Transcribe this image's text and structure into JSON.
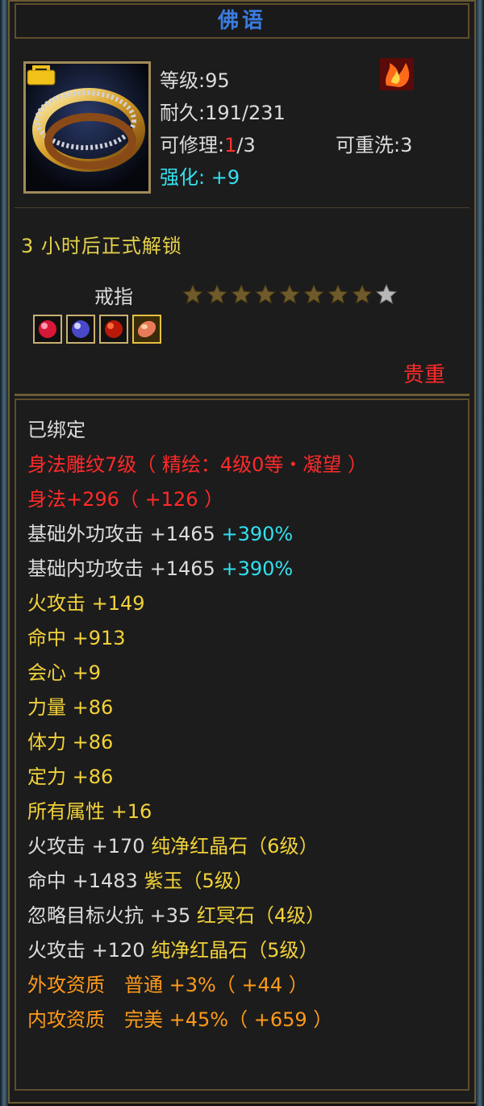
{
  "window": {
    "title": "佛语"
  },
  "item": {
    "level": "等级:95",
    "durability": "耐久:191/231",
    "repair_label": "可修理:",
    "repair_used": "1",
    "repair_total": "/3",
    "rewash": "可重洗:3",
    "enhance_label": "强化:",
    "enhance_value": "+9",
    "unlock_text": "3 小时后正式解锁",
    "type": "戒指",
    "star_rating": {
      "filled": 8,
      "total": 9
    },
    "rarity": "贵重"
  },
  "attributes": [
    {
      "parts": [
        {
          "text": "已绑定",
          "color": "white"
        }
      ]
    },
    {
      "parts": [
        {
          "text": "身法雕纹7级（ 精绘：4级0等・凝望 ）",
          "color": "red"
        }
      ]
    },
    {
      "parts": [
        {
          "text": "身法+296（ +126 ）",
          "color": "red"
        }
      ]
    },
    {
      "parts": [
        {
          "text": "基础外功攻击 +1465 ",
          "color": "white"
        },
        {
          "text": "+390%",
          "color": "cyan"
        }
      ]
    },
    {
      "parts": [
        {
          "text": "基础内功攻击 +1465 ",
          "color": "white"
        },
        {
          "text": "+390%",
          "color": "cyan"
        }
      ]
    },
    {
      "parts": [
        {
          "text": "火攻击 +149",
          "color": "yellow"
        }
      ]
    },
    {
      "parts": [
        {
          "text": "命中 +913",
          "color": "yellow"
        }
      ]
    },
    {
      "parts": [
        {
          "text": "会心 +9",
          "color": "yellow"
        }
      ]
    },
    {
      "parts": [
        {
          "text": "力量 +86",
          "color": "yellow"
        }
      ]
    },
    {
      "parts": [
        {
          "text": "体力 +86",
          "color": "yellow"
        }
      ]
    },
    {
      "parts": [
        {
          "text": "定力 +86",
          "color": "yellow"
        }
      ]
    },
    {
      "parts": [
        {
          "text": "所有属性 +16",
          "color": "yellow"
        }
      ]
    },
    {
      "parts": [
        {
          "text": "火攻击 +170 ",
          "color": "white"
        },
        {
          "text": "纯净红晶石（6级）",
          "color": "yellow"
        }
      ]
    },
    {
      "parts": [
        {
          "text": "命中 +1483 ",
          "color": "white"
        },
        {
          "text": "紫玉（5级）",
          "color": "yellow"
        }
      ]
    },
    {
      "parts": [
        {
          "text": "忽略目标火抗 +35 ",
          "color": "white"
        },
        {
          "text": "红冥石（4级）",
          "color": "yellow"
        }
      ]
    },
    {
      "parts": [
        {
          "text": "火攻击 +120 ",
          "color": "white"
        },
        {
          "text": "纯净红晶石（5级）",
          "color": "yellow"
        }
      ]
    },
    {
      "parts": [
        {
          "text": "外攻资质　普通 +3%（ +44 ）",
          "color": "orange"
        }
      ]
    },
    {
      "parts": [
        {
          "text": "内攻资质　完美 +45%（ +659 ）",
          "color": "orange"
        }
      ]
    }
  ],
  "colors": {
    "title": "#3a7be0",
    "red": "#ff2a2a",
    "yellow": "#f2d23a",
    "orange": "#ff9a1a",
    "cyan": "#33e0f0",
    "white": "#dcdcdc"
  },
  "icons": {
    "item": "ring-icon",
    "lock": "lock-badge-icon",
    "element": "flame-icon",
    "gems": [
      "red-gem-icon",
      "purple-gem-icon",
      "red-gem-icon",
      "pink-gem-icon"
    ]
  }
}
